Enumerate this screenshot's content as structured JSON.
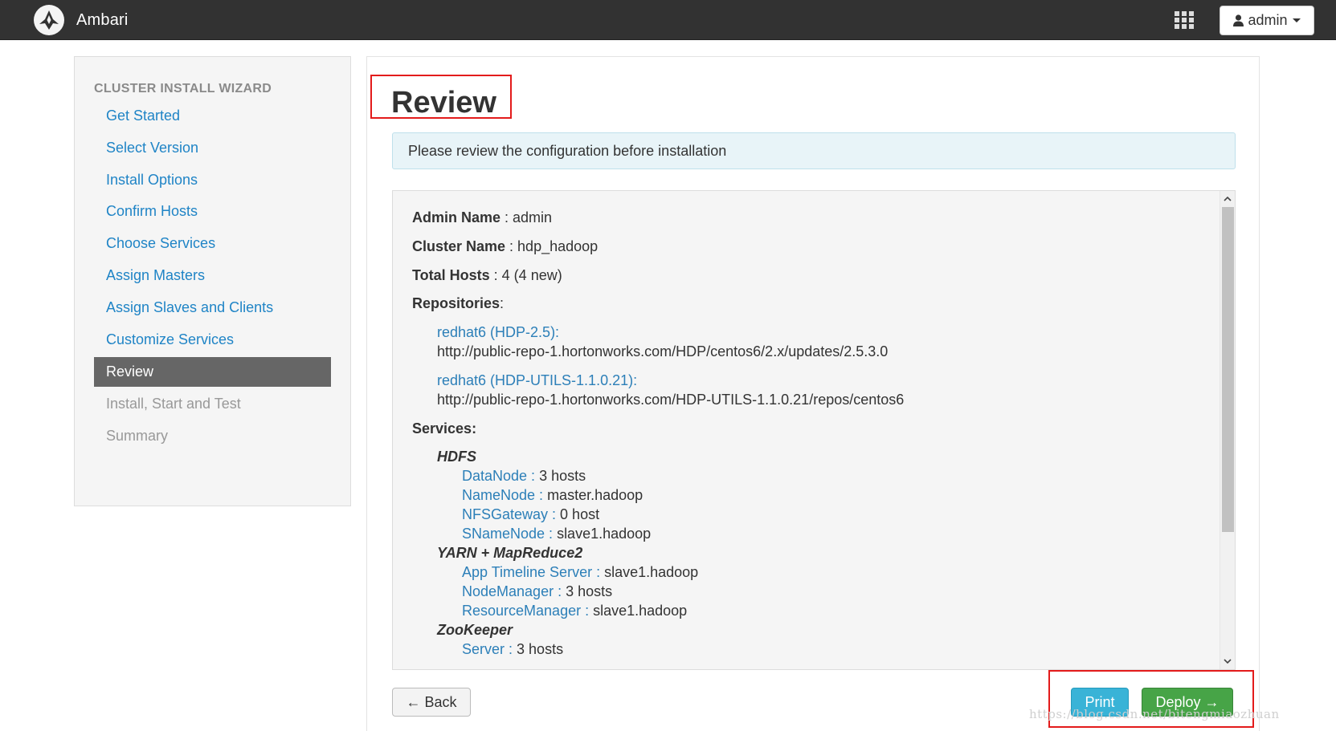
{
  "app": {
    "name": "Ambari",
    "user_label": "admin"
  },
  "wizard": {
    "title": "CLUSTER INSTALL WIZARD",
    "steps": [
      {
        "label": "Get Started",
        "state": "link"
      },
      {
        "label": "Select Version",
        "state": "link"
      },
      {
        "label": "Install Options",
        "state": "link"
      },
      {
        "label": "Confirm Hosts",
        "state": "link"
      },
      {
        "label": "Choose Services",
        "state": "link"
      },
      {
        "label": "Assign Masters",
        "state": "link"
      },
      {
        "label": "Assign Slaves and Clients",
        "state": "link"
      },
      {
        "label": "Customize Services",
        "state": "link"
      },
      {
        "label": "Review",
        "state": "active"
      },
      {
        "label": "Install, Start and Test",
        "state": "disabled"
      },
      {
        "label": "Summary",
        "state": "disabled"
      }
    ]
  },
  "main": {
    "title": "Review",
    "info": "Please review the configuration before installation",
    "admin_name_label": "Admin Name",
    "admin_name_value": " : admin",
    "cluster_name_label": "Cluster Name",
    "cluster_name_value": " : hdp_hadoop",
    "total_hosts_label": "Total Hosts",
    "total_hosts_value": " : 4 (4 new)",
    "repositories_label": "Repositories",
    "repositories_colon": ":",
    "repos": [
      {
        "name": "redhat6 (HDP-2.5):",
        "url": "http://public-repo-1.hortonworks.com/HDP/centos6/2.x/updates/2.5.3.0"
      },
      {
        "name": "redhat6 (HDP-UTILS-1.1.0.21):",
        "url": "http://public-repo-1.hortonworks.com/HDP-UTILS-1.1.0.21/repos/centos6"
      }
    ],
    "services_label": "Services:",
    "services": [
      {
        "name": "HDFS",
        "components": [
          {
            "name": "DataNode : ",
            "value": "3 hosts"
          },
          {
            "name": "NameNode : ",
            "value": "master.hadoop"
          },
          {
            "name": "NFSGateway : ",
            "value": "0 host"
          },
          {
            "name": "SNameNode : ",
            "value": "slave1.hadoop"
          }
        ]
      },
      {
        "name": "YARN + MapReduce2",
        "components": [
          {
            "name": "App Timeline Server : ",
            "value": "slave1.hadoop"
          },
          {
            "name": "NodeManager : ",
            "value": "3 hosts"
          },
          {
            "name": "ResourceManager : ",
            "value": "slave1.hadoop"
          }
        ]
      },
      {
        "name": "ZooKeeper",
        "components": [
          {
            "name": "Server : ",
            "value": "3 hosts"
          }
        ]
      }
    ],
    "back_label": "← Back",
    "print_label": "Print",
    "deploy_label": "Deploy →"
  },
  "watermark": "https://blog.csdn.net/bitengmiaozhuan",
  "colors": {
    "navbar": "#323232",
    "link": "#1f84c6",
    "active_step": "#666666",
    "print": "#39b3d7",
    "deploy": "#47a447",
    "highlight": "#e31b1b"
  },
  "icons": [
    "ambari-logo-icon",
    "apps-grid-icon",
    "user-icon",
    "caret-down-icon",
    "scroll-up-icon",
    "scroll-down-icon"
  ]
}
